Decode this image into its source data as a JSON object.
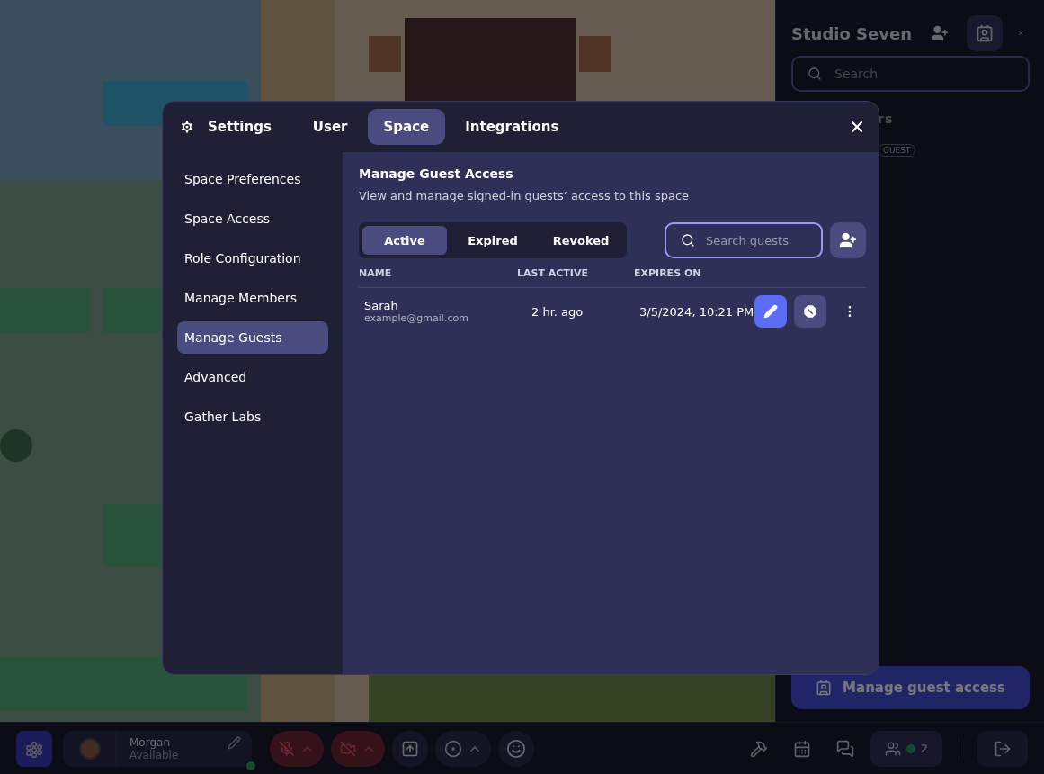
{
  "sidebar": {
    "title": "Studio Seven",
    "invite_selected": false,
    "guests_selected": true,
    "search": {
      "placeholder": "Search"
    },
    "section_label": "rs",
    "badge": "GUEST",
    "primary_button": "Manage guest access"
  },
  "modal": {
    "heading": "Settings",
    "tabs": [
      {
        "label": "User",
        "selected": false
      },
      {
        "label": "Space",
        "selected": true
      },
      {
        "label": "Integrations",
        "selected": false
      }
    ],
    "nav": [
      {
        "label": "Space Preferences",
        "selected": false
      },
      {
        "label": "Space Access",
        "selected": false
      },
      {
        "label": "Role Configuration",
        "selected": false
      },
      {
        "label": "Manage Members",
        "selected": false
      },
      {
        "label": "Manage Guests",
        "selected": true
      },
      {
        "label": "Advanced",
        "selected": false
      },
      {
        "label": "Gather Labs",
        "selected": false
      }
    ],
    "title": "Manage Guest Access",
    "description": "View and manage signed-in guests’ access to this space",
    "filters": [
      {
        "label": "Active",
        "selected": true
      },
      {
        "label": "Expired",
        "selected": false
      },
      {
        "label": "Revoked",
        "selected": false
      }
    ],
    "search": {
      "placeholder": "Search guests"
    },
    "columns": [
      "NAME",
      "LAST ACTIVE",
      "EXPIRES ON"
    ],
    "rows": [
      {
        "name": "Sarah",
        "email": "example@gmail.com",
        "last_active": "2 hr. ago",
        "expires_on": "3/5/2024, 10:21 PM"
      }
    ]
  },
  "bottom_bar": {
    "user": {
      "name": "Morgan",
      "status": "Available",
      "online": true
    },
    "mic_muted": true,
    "camera_off": true,
    "participants": "2"
  }
}
